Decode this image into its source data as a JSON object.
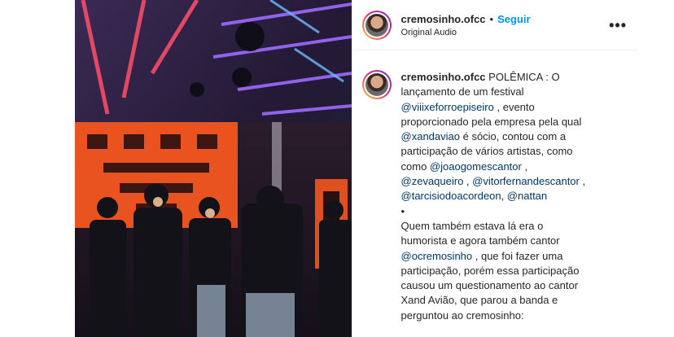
{
  "post": {
    "username": "cremosinho.ofcc",
    "separator": "•",
    "follow_label": "Seguir",
    "audio_label": "Original Audio",
    "more_icon": "more-horizontal-icon",
    "more_label": "•••"
  },
  "caption": {
    "username": "cremosinho.ofcc",
    "segments": [
      {
        "text": " POLÊMICA : O lançamento de um festival ",
        "type": "text"
      },
      {
        "text": "@viiixeforroepiseiro",
        "type": "mention"
      },
      {
        "text": " , evento proporcionado pela empresa pela qual ",
        "type": "text"
      },
      {
        "text": "@xandaviao",
        "type": "mention"
      },
      {
        "text": " é sócio, contou com a participação de vários artistas, como como ",
        "type": "text"
      },
      {
        "text": "@joaogomescantor",
        "type": "mention"
      },
      {
        "text": " , ",
        "type": "text"
      },
      {
        "text": "@zevaqueiro",
        "type": "mention"
      },
      {
        "text": " , ",
        "type": "text"
      },
      {
        "text": "@vitorfernandescantor",
        "type": "mention"
      },
      {
        "text": " , ",
        "type": "text"
      },
      {
        "text": "@tarcisiodoacordeon",
        "type": "mention"
      },
      {
        "text": ", ",
        "type": "text"
      },
      {
        "text": "@nattan",
        "type": "mention"
      },
      {
        "text": "\n•\nQuem também estava lá era o humorista e agora também cantor ",
        "type": "text"
      },
      {
        "text": "@ocremosinho",
        "type": "mention"
      },
      {
        "text": " , que foi fazer uma participação, porém essa participação causou um questionamento ao cantor Xand Avião, que parou a banda e perguntou ao cremosinho:",
        "type": "text"
      }
    ]
  },
  "colors": {
    "link": "#0095f6",
    "mention": "#00376b",
    "text": "#262626"
  }
}
